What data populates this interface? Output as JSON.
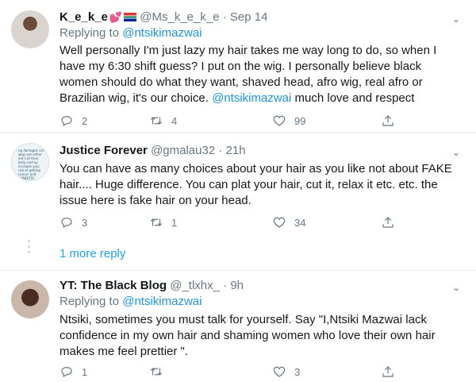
{
  "tweets": [
    {
      "name": "K_e_k_e",
      "handle": "@Ms_k_e_k_e",
      "dot": "·",
      "time": "Sep 14",
      "replying_prefix": "Replying to ",
      "replying_to": "@ntsikimazwai",
      "text": "Well personally I'm just lazy my hair takes me way long to do, so when I have my 6:30 shift guess? I put on the wig. I personally believe black women should do what they want, shaved head, afro wig, real afro or Brazilian wig, it's our choice. ",
      "text_mention": "@ntsikimazwai",
      "text_after": " much love and respect",
      "replies": "2",
      "retweets": "4",
      "likes": "99"
    },
    {
      "name": "Justice Forever",
      "handle": "@gmalau32",
      "dot": "·",
      "time": "21h",
      "text": "You can have as many choices about your hair as you like not about FAKE hair.... Huge difference. You can plat your hair, cut it, relax it etc. etc. the issue here is fake hair on your head.",
      "avatar_text": "ng damages cal wigs and other ore's of their body and ay increase your risk of getting cancer and CONDITIO",
      "replies": "3",
      "retweets": "1",
      "likes": "34"
    },
    {
      "name": "YT: The Black Blog",
      "handle": "@_tlxhx_",
      "dot": "·",
      "time": "9h",
      "replying_prefix": "Replying to ",
      "replying_to": "@ntsikimazwai",
      "text": "Ntsiki, sometimes you must talk for yourself.  Say \"I,Ntsiki Mazwai lack confidence in my own hair and shaming women who love their own hair makes me feel prettier \".",
      "replies": "1",
      "retweets": "",
      "likes": "3"
    }
  ],
  "more_replies": "1 more reply",
  "icons": {
    "reply": "reply-icon",
    "retweet": "retweet-icon",
    "like": "heart-icon",
    "share": "share-icon",
    "caret": "chevron-down-icon"
  }
}
